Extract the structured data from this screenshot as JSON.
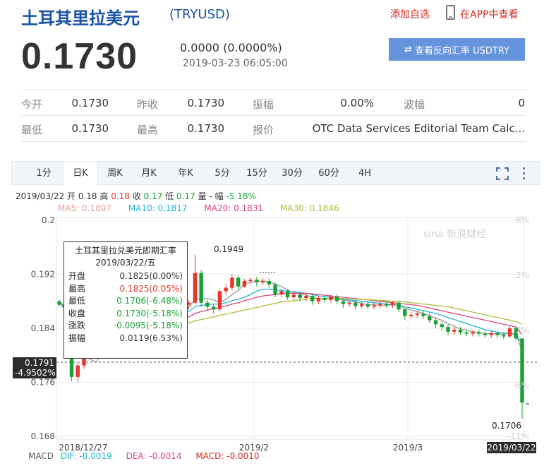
{
  "header": {
    "title_zh": "土耳其里拉美元",
    "title_en": "(TRYUSD)",
    "add_watch": "添加自选",
    "view_app": "在APP中查看",
    "price": "0.1730",
    "change": "0.0000 (0.0000%)",
    "datetime": "2019-03-23 06:05:00",
    "reverse_button": "查看反向汇率 USDTRY"
  },
  "stats": {
    "row1": [
      {
        "label": "今开",
        "value": "0.1730"
      },
      {
        "label": "昨收",
        "value": "0.1730"
      },
      {
        "label": "振幅",
        "value": "0.00%"
      },
      {
        "label": "波幅",
        "value": "0"
      }
    ],
    "row2": [
      {
        "label": "最低",
        "value": "0.1730"
      },
      {
        "label": "最高",
        "value": "0.1730"
      },
      {
        "label": "报价",
        "value": "OTC Data Services Editorial Team Calc..."
      }
    ]
  },
  "tabs": [
    "1分",
    "日K",
    "周K",
    "月K",
    "年K",
    "5分",
    "15分",
    "30分",
    "60分",
    "4H"
  ],
  "active_tab": "日K",
  "info_line": {
    "date": "2019/03/22",
    "open_label": "开",
    "open": "0.18",
    "high_label": "高",
    "high": "0.18",
    "close_label": "收",
    "close": "0.17",
    "low_label": "低",
    "low": "0.17",
    "volume_label": "量",
    "volume": "-",
    "amp_label": "幅",
    "amp": "-5.18%"
  },
  "ma_line": {
    "ma5": "MA5: 0.1807",
    "ma10": "MA10: 0.1817",
    "ma20": "MA20: 0.1831",
    "ma30": "MA30: 0.1846"
  },
  "tooltip": {
    "title": "土耳其里拉兑美元即期汇率",
    "date": "2019/03/22/五",
    "rows": [
      {
        "k": "开盘",
        "v": "0.1825(0.00%)",
        "color": "#333333"
      },
      {
        "k": "最高",
        "v": "0.1825(0.05%)",
        "color": "#e8362a"
      },
      {
        "k": "最低",
        "v": "0.1706(-6.48%)",
        "color": "#1aa033"
      },
      {
        "k": "收盘",
        "v": "0.1730(-5.18%)",
        "color": "#1aa033"
      },
      {
        "k": "涨跌",
        "v": "-0.0095(-5.18%)",
        "color": "#1aa033"
      },
      {
        "k": "振幅",
        "v": "0.0119(6.53%)",
        "color": "#333333"
      }
    ]
  },
  "price_tag": {
    "price": "0.1791",
    "pct": "-4.9502%"
  },
  "last_tag": "2019/03/22",
  "macd": {
    "label": "MACD",
    "dif": "DIF: -0.0019",
    "dea": "DEA: -0.0014",
    "macd": "MACD: -0.0010"
  },
  "colors": {
    "up": "#e8362a",
    "down": "#1aa033",
    "ma5": "#888888",
    "ma10": "#1fb5d6",
    "ma20": "#e0457b",
    "ma30": "#a8c038",
    "accent": "#1a52a5",
    "button": "#6593dc"
  },
  "watermark": "sina 新浪财经",
  "chart_data": {
    "type": "candlestick",
    "x_labels": [
      "2018/12/27",
      "2019/2",
      "2019/3"
    ],
    "y_ticks": [
      "0.2",
      "0.192",
      "0.184",
      "0.176",
      "0.168"
    ],
    "right_ticks": [
      "6%",
      "2%",
      "-2%",
      "-6%",
      "-11%"
    ],
    "ylim": [
      0.168,
      0.2
    ],
    "annotations": [
      {
        "text": "0.1949",
        "value": 0.1949
      },
      {
        "text": "0.1706",
        "value": 0.1706
      }
    ],
    "candles": [
      [
        0.188,
        0.1875,
        0.1882,
        0.1872
      ],
      [
        0.1852,
        0.1828,
        0.1856,
        0.1826
      ],
      [
        0.1828,
        0.1768,
        0.183,
        0.1762
      ],
      [
        0.1768,
        0.1785,
        0.179,
        0.176
      ],
      [
        0.1785,
        0.18,
        0.1804,
        0.178
      ],
      [
        0.18,
        0.1812,
        0.1815,
        0.1796
      ],
      [
        0.1812,
        0.182,
        0.1824,
        0.1808
      ],
      [
        0.182,
        0.1828,
        0.1832,
        0.1815
      ],
      [
        0.1828,
        0.1836,
        0.184,
        0.1824
      ],
      [
        0.1836,
        0.1843,
        0.1847,
        0.1832
      ],
      [
        0.1843,
        0.1849,
        0.1853,
        0.1838
      ],
      [
        0.1849,
        0.1855,
        0.186,
        0.1845
      ],
      [
        0.1855,
        0.1858,
        0.1862,
        0.185
      ],
      [
        0.1858,
        0.186,
        0.1864,
        0.1853
      ],
      [
        0.186,
        0.1862,
        0.1866,
        0.1855
      ],
      [
        0.1862,
        0.1856,
        0.1866,
        0.1852
      ],
      [
        0.1856,
        0.1862,
        0.1866,
        0.1852
      ],
      [
        0.1862,
        0.186,
        0.1866,
        0.1855
      ],
      [
        0.186,
        0.1872,
        0.1875,
        0.1856
      ],
      [
        0.1872,
        0.187,
        0.1876,
        0.1865
      ],
      [
        0.187,
        0.1875,
        0.1878,
        0.1866
      ],
      [
        0.1875,
        0.1878,
        0.1882,
        0.1868
      ],
      [
        0.1878,
        0.1922,
        0.1949,
        0.1875
      ],
      [
        0.1922,
        0.1878,
        0.1926,
        0.1872
      ],
      [
        0.1878,
        0.1872,
        0.1882,
        0.1866
      ],
      [
        0.1872,
        0.1868,
        0.1876,
        0.1862
      ],
      [
        0.1868,
        0.1895,
        0.1898,
        0.1866
      ],
      [
        0.1895,
        0.19,
        0.1905,
        0.189
      ],
      [
        0.19,
        0.1915,
        0.192,
        0.1896
      ],
      [
        0.1915,
        0.1902,
        0.1918,
        0.1898
      ],
      [
        0.1902,
        0.191,
        0.1913,
        0.19
      ],
      [
        0.191,
        0.1912,
        0.1915,
        0.1906
      ],
      [
        0.1912,
        0.1908,
        0.1916,
        0.1902
      ],
      [
        0.1908,
        0.191,
        0.1914,
        0.1904
      ],
      [
        0.191,
        0.1905,
        0.1914,
        0.19
      ],
      [
        0.1905,
        0.189,
        0.1908,
        0.1886
      ],
      [
        0.189,
        0.1895,
        0.1898,
        0.1886
      ],
      [
        0.1895,
        0.1886,
        0.1898,
        0.1882
      ],
      [
        0.1886,
        0.189,
        0.1894,
        0.1882
      ],
      [
        0.189,
        0.1885,
        0.1894,
        0.188
      ],
      [
        0.1885,
        0.1888,
        0.1892,
        0.188
      ],
      [
        0.1888,
        0.188,
        0.1891,
        0.1875
      ],
      [
        0.188,
        0.1885,
        0.1888,
        0.1876
      ],
      [
        0.1885,
        0.1882,
        0.1888,
        0.1878
      ],
      [
        0.1882,
        0.1887,
        0.189,
        0.1878
      ],
      [
        0.1887,
        0.188,
        0.189,
        0.1876
      ],
      [
        0.188,
        0.1876,
        0.1884,
        0.187
      ],
      [
        0.1876,
        0.1878,
        0.1882,
        0.1872
      ],
      [
        0.1878,
        0.1873,
        0.1882,
        0.1868
      ],
      [
        0.1873,
        0.1876,
        0.188,
        0.187
      ],
      [
        0.1876,
        0.1872,
        0.188,
        0.1868
      ],
      [
        0.1872,
        0.1874,
        0.1878,
        0.1868
      ],
      [
        0.1874,
        0.1876,
        0.188,
        0.187
      ],
      [
        0.1876,
        0.1874,
        0.188,
        0.187
      ],
      [
        0.1874,
        0.1878,
        0.1881,
        0.187
      ],
      [
        0.1878,
        0.1868,
        0.188,
        0.1864
      ],
      [
        0.1868,
        0.1858,
        0.187,
        0.1852
      ],
      [
        0.1858,
        0.186,
        0.1864,
        0.1854
      ],
      [
        0.186,
        0.1862,
        0.1866,
        0.1856
      ],
      [
        0.1862,
        0.1858,
        0.1866,
        0.1854
      ],
      [
        0.1858,
        0.1852,
        0.1862,
        0.1848
      ],
      [
        0.1852,
        0.1846,
        0.1856,
        0.184
      ],
      [
        0.1846,
        0.1842,
        0.185,
        0.1836
      ],
      [
        0.1842,
        0.1835,
        0.1846,
        0.183
      ],
      [
        0.1835,
        0.1838,
        0.1842,
        0.183
      ],
      [
        0.1838,
        0.1834,
        0.1842,
        0.183
      ],
      [
        0.1834,
        0.1832,
        0.1838,
        0.1828
      ],
      [
        0.1832,
        0.1834,
        0.1837,
        0.1828
      ],
      [
        0.1834,
        0.1832,
        0.1838,
        0.1828
      ],
      [
        0.1832,
        0.183,
        0.1836,
        0.1826
      ],
      [
        0.183,
        0.1833,
        0.1836,
        0.1826
      ],
      [
        0.1833,
        0.183,
        0.1836,
        0.1826
      ],
      [
        0.183,
        0.1828,
        0.1834,
        0.1824
      ],
      [
        0.1828,
        0.184,
        0.1843,
        0.1826
      ],
      [
        0.184,
        0.1825,
        0.1843,
        0.1822
      ],
      [
        0.1825,
        0.173,
        0.1825,
        0.1706
      ]
    ],
    "ma_series": {
      "ma5": [
        0.188,
        0.1866,
        0.1828,
        0.1816,
        0.1808,
        0.1794,
        0.179,
        0.1805,
        0.1818,
        0.1827,
        0.1834,
        0.1841,
        0.1848,
        0.1853,
        0.1857,
        0.1859,
        0.186,
        0.186,
        0.1862,
        0.1864,
        0.1868,
        0.1871,
        0.1883,
        0.1884,
        0.1884,
        0.1882,
        0.1878,
        0.1883,
        0.189,
        0.1896,
        0.1906,
        0.1908,
        0.191,
        0.191,
        0.1909,
        0.1905,
        0.1902,
        0.1897,
        0.1893,
        0.1891,
        0.1889,
        0.1886,
        0.1884,
        0.1883,
        0.1884,
        0.1883,
        0.1882,
        0.188,
        0.1879,
        0.1877,
        0.1875,
        0.1875,
        0.1874,
        0.1874,
        0.1875,
        0.1874,
        0.187,
        0.1867,
        0.1865,
        0.1862,
        0.1859,
        0.1855,
        0.1852,
        0.1847,
        0.1843,
        0.1839,
        0.1837,
        0.1835,
        0.1834,
        0.1832,
        0.1832,
        0.1832,
        0.1831,
        0.1833,
        0.1831,
        0.1807
      ],
      "ma10": [
        0.188,
        0.1866,
        0.184,
        0.1826,
        0.1818,
        0.1812,
        0.181,
        0.1812,
        0.1815,
        0.1817,
        0.1812,
        0.1815,
        0.1826,
        0.1836,
        0.1842,
        0.1847,
        0.1851,
        0.1854,
        0.1857,
        0.1859,
        0.1862,
        0.1865,
        0.1872,
        0.1874,
        0.1875,
        0.1876,
        0.1876,
        0.1878,
        0.1881,
        0.1883,
        0.1886,
        0.189,
        0.1895,
        0.1898,
        0.1898,
        0.1897,
        0.1896,
        0.1895,
        0.1894,
        0.1893,
        0.1892,
        0.189,
        0.1888,
        0.1887,
        0.1886,
        0.1884,
        0.1883,
        0.1882,
        0.1881,
        0.188,
        0.1879,
        0.1878,
        0.1877,
        0.1876,
        0.1875,
        0.1874,
        0.1872,
        0.187,
        0.1868,
        0.1866,
        0.1864,
        0.1862,
        0.1859,
        0.1856,
        0.1853,
        0.185,
        0.1847,
        0.1844,
        0.1841,
        0.1838,
        0.1836,
        0.1834,
        0.1833,
        0.1832,
        0.1831,
        0.1817
      ],
      "ma20": [
        0.188,
        0.187,
        0.185,
        0.1838,
        0.183,
        0.1826,
        0.1822,
        0.182,
        0.182,
        0.182,
        0.182,
        0.1822,
        0.1826,
        0.183,
        0.1834,
        0.1838,
        0.1842,
        0.1845,
        0.1848,
        0.1851,
        0.1854,
        0.1857,
        0.1862,
        0.1865,
        0.1867,
        0.1869,
        0.1871,
        0.1873,
        0.1876,
        0.1878,
        0.1881,
        0.1883,
        0.1886,
        0.1888,
        0.1889,
        0.189,
        0.1891,
        0.1892,
        0.1892,
        0.1892,
        0.1892,
        0.1891,
        0.189,
        0.1889,
        0.1888,
        0.1887,
        0.1886,
        0.1885,
        0.1884,
        0.1883,
        0.1882,
        0.1881,
        0.188,
        0.1879,
        0.1878,
        0.1877,
        0.1876,
        0.1875,
        0.1874,
        0.1872,
        0.187,
        0.1868,
        0.1866,
        0.1864,
        0.1862,
        0.186,
        0.1858,
        0.1856,
        0.1854,
        0.1852,
        0.185,
        0.1848,
        0.1846,
        0.1844,
        0.1842,
        0.1831
      ],
      "ma30": [
        0.188,
        0.1872,
        0.1858,
        0.185,
        0.1844,
        0.184,
        0.1836,
        0.1834,
        0.1832,
        0.1831,
        0.183,
        0.183,
        0.1831,
        0.1832,
        0.1834,
        0.1836,
        0.1838,
        0.184,
        0.1842,
        0.1844,
        0.1846,
        0.1848,
        0.1851,
        0.1853,
        0.1855,
        0.1857,
        0.1859,
        0.1861,
        0.1863,
        0.1865,
        0.1867,
        0.1869,
        0.1871,
        0.1873,
        0.1875,
        0.1877,
        0.1879,
        0.188,
        0.1881,
        0.1882,
        0.1883,
        0.1884,
        0.1884,
        0.1884,
        0.1884,
        0.1884,
        0.1884,
        0.1884,
        0.1883,
        0.1883,
        0.1882,
        0.1882,
        0.1881,
        0.1881,
        0.188,
        0.188,
        0.1879,
        0.1878,
        0.1877,
        0.1876,
        0.1875,
        0.1874,
        0.1873,
        0.1872,
        0.187,
        0.1868,
        0.1866,
        0.1864,
        0.1862,
        0.186,
        0.1858,
        0.1856,
        0.1854,
        0.1852,
        0.185,
        0.1846
      ]
    }
  }
}
